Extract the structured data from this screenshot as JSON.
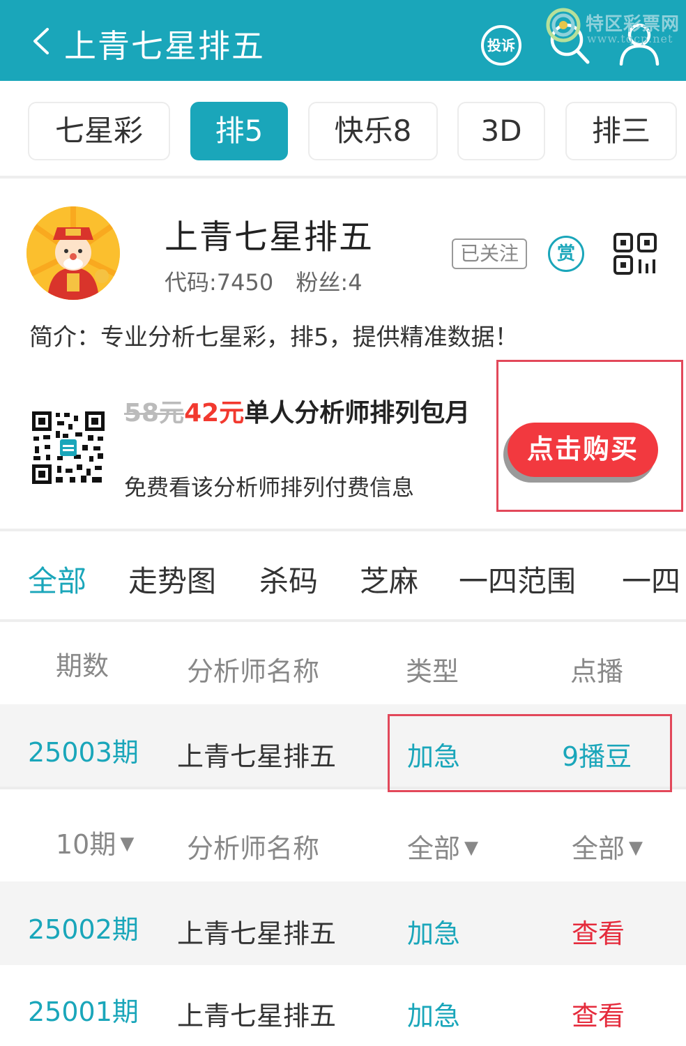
{
  "header": {
    "title": "上青七星排五",
    "complain_label": "投诉",
    "colors": {
      "bar": "#1aa6ba",
      "text": "#ffffff"
    }
  },
  "watermark": {
    "brand": "特区彩票网",
    "url": "www.tqcp.net"
  },
  "lottery_tabs": [
    {
      "label": "七星彩",
      "active": false
    },
    {
      "label": "排5",
      "active": true
    },
    {
      "label": "快乐8",
      "active": false
    },
    {
      "label": "3D",
      "active": false
    },
    {
      "label": "排三",
      "active": false
    }
  ],
  "profile": {
    "name": "上青七星排五",
    "code": "代码:7450",
    "fans": "粉丝:4",
    "follow_label": "已关注",
    "reward_label": "赏",
    "intro": "简介：专业分析七星彩，排5，提供精准数据！"
  },
  "promo": {
    "old_price": "58元",
    "new_price": "42元",
    "title": "单人分析师排列包月",
    "subtitle": "免费看该分析师排列付费信息",
    "buy_label": "点击购买"
  },
  "category_tabs": [
    {
      "label": "全部",
      "active": true
    },
    {
      "label": "走势图",
      "active": false
    },
    {
      "label": "杀码",
      "active": false
    },
    {
      "label": "芝麻",
      "active": false
    },
    {
      "label": "一四范围",
      "active": false
    },
    {
      "label": "一四",
      "active": false
    }
  ],
  "table": {
    "headers": {
      "period": "期数",
      "analyst": "分析师名称",
      "type": "类型",
      "play": "点播"
    },
    "current": {
      "period": "25003期",
      "analyst": "上青七星排五",
      "type": "加急",
      "play": "9播豆"
    },
    "filters": {
      "period": "10期",
      "analyst": "分析师名称",
      "type": "全部",
      "play": "全部"
    },
    "rows": [
      {
        "period": "25002期",
        "analyst": "上青七星排五",
        "type": "加急",
        "action": "查看"
      },
      {
        "period": "25001期",
        "analyst": "上青七星排五",
        "type": "加急",
        "action": "查看"
      }
    ]
  },
  "colors": {
    "accent": "#1aa6ba",
    "price_red": "#f2392f",
    "view_red": "#e52b3c",
    "highlight_box": "#e2485a"
  }
}
